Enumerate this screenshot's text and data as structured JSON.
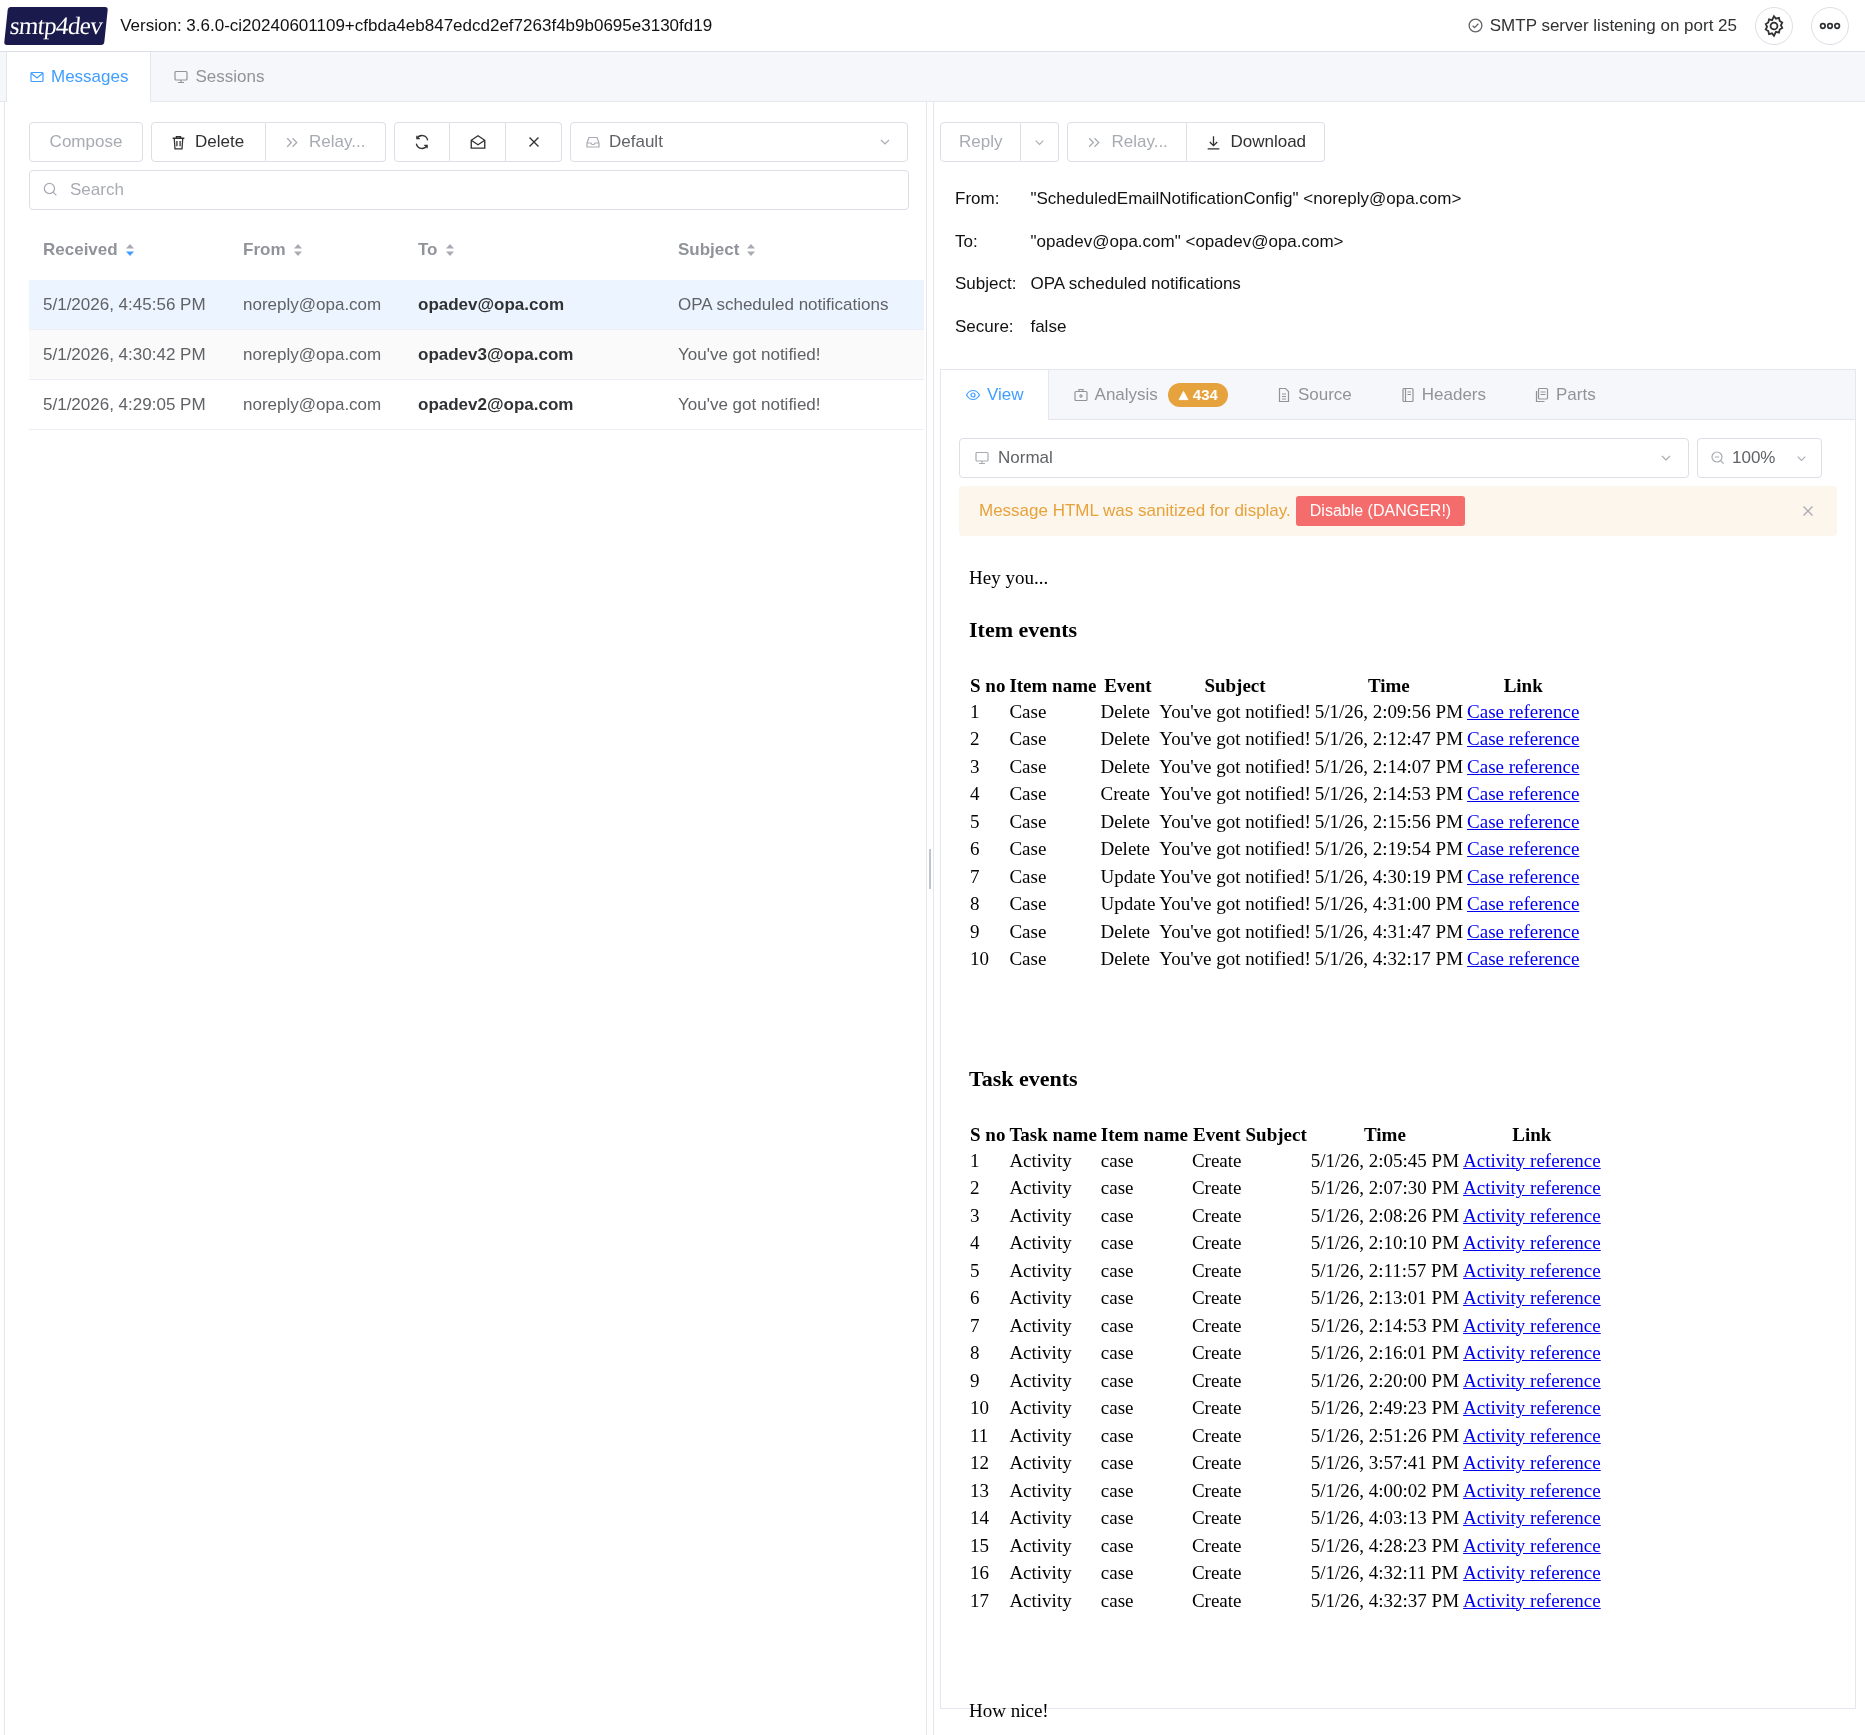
{
  "header": {
    "logo": "smtp4dev",
    "version": "Version: 3.6.0-ci20240601109+cfbda4eb847edcd2ef7263f4b9b0695e3130fd19",
    "status": "SMTP server listening on port 25"
  },
  "tabs": [
    {
      "label": "Messages",
      "selected": true
    },
    {
      "label": "Sessions",
      "selected": false
    }
  ],
  "toolbar": {
    "compose": "Compose",
    "delete": "Delete",
    "relay": "Relay...",
    "mailbox": "Default"
  },
  "search": {
    "placeholder": "Search"
  },
  "messages": {
    "columns": [
      {
        "label": "Received",
        "sorted": true
      },
      {
        "label": "From",
        "sorted": false
      },
      {
        "label": "To",
        "sorted": false
      },
      {
        "label": "Subject",
        "sorted": false
      }
    ],
    "rows": [
      {
        "received": "5/1/2026, 4:45:56 PM",
        "from": "noreply@opa.com",
        "to": "opadev@opa.com",
        "subject": "OPA scheduled notifications",
        "selected": true
      },
      {
        "received": "5/1/2026, 4:30:42 PM",
        "from": "noreply@opa.com",
        "to": "opadev3@opa.com",
        "subject": "You've got notified!",
        "selected": false
      },
      {
        "received": "5/1/2026, 4:29:05 PM",
        "from": "noreply@opa.com",
        "to": "opadev2@opa.com",
        "subject": "You've got notified!",
        "selected": false
      }
    ]
  },
  "detail": {
    "reply": "Reply",
    "relay": "Relay...",
    "download": "Download",
    "fields": [
      {
        "label": "From:",
        "value": "\"ScheduledEmailNotificationConfig\" <noreply@opa.com>"
      },
      {
        "label": "To:",
        "value": "\"opadev@opa.com\" <opadev@opa.com>"
      },
      {
        "label": "Subject:",
        "value": "OPA scheduled notifications"
      },
      {
        "label": "Secure:",
        "value": "false"
      }
    ],
    "tabs": [
      {
        "label": "View",
        "selected": true
      },
      {
        "label": "Analysis",
        "selected": false,
        "badge": "434"
      },
      {
        "label": "Source",
        "selected": false
      },
      {
        "label": "Headers",
        "selected": false
      },
      {
        "label": "Parts",
        "selected": false
      }
    ],
    "view_mode": "Normal",
    "zoom": "100%",
    "warning": {
      "text": "Message HTML was sanitized for display.",
      "button": "Disable (DANGER!)"
    }
  },
  "email": {
    "greeting": "Hey you...",
    "closing": "How nice!",
    "tables": [
      {
        "title": "Item events",
        "columns": [
          "S no",
          "Item name",
          "Event",
          "Subject",
          "Time",
          "Link"
        ],
        "rows": [
          [
            "1",
            "Case",
            "Delete",
            "You've got notified!",
            "5/1/26, 2:09:56 PM",
            "Case reference"
          ],
          [
            "2",
            "Case",
            "Delete",
            "You've got notified!",
            "5/1/26, 2:12:47 PM",
            "Case reference"
          ],
          [
            "3",
            "Case",
            "Delete",
            "You've got notified!",
            "5/1/26, 2:14:07 PM",
            "Case reference"
          ],
          [
            "4",
            "Case",
            "Create",
            "You've got notified!",
            "5/1/26, 2:14:53 PM",
            "Case reference"
          ],
          [
            "5",
            "Case",
            "Delete",
            "You've got notified!",
            "5/1/26, 2:15:56 PM",
            "Case reference"
          ],
          [
            "6",
            "Case",
            "Delete",
            "You've got notified!",
            "5/1/26, 2:19:54 PM",
            "Case reference"
          ],
          [
            "7",
            "Case",
            "Update",
            "You've got notified!",
            "5/1/26, 4:30:19 PM",
            "Case reference"
          ],
          [
            "8",
            "Case",
            "Update",
            "You've got notified!",
            "5/1/26, 4:31:00 PM",
            "Case reference"
          ],
          [
            "9",
            "Case",
            "Delete",
            "You've got notified!",
            "5/1/26, 4:31:47 PM",
            "Case reference"
          ],
          [
            "10",
            "Case",
            "Delete",
            "You've got notified!",
            "5/1/26, 4:32:17 PM",
            "Case reference"
          ]
        ]
      },
      {
        "title": "Task events",
        "columns": [
          "S no",
          "Task name",
          "Item name",
          "Event",
          "Subject",
          "Time",
          "Link"
        ],
        "rows": [
          [
            "1",
            "Activity",
            "case",
            "Create",
            null,
            "5/1/26, 2:05:45 PM",
            "Activity reference"
          ],
          [
            "2",
            "Activity",
            "case",
            "Create",
            null,
            "5/1/26, 2:07:30 PM",
            "Activity reference"
          ],
          [
            "3",
            "Activity",
            "case",
            "Create",
            null,
            "5/1/26, 2:08:26 PM",
            "Activity reference"
          ],
          [
            "4",
            "Activity",
            "case",
            "Create",
            null,
            "5/1/26, 2:10:10 PM",
            "Activity reference"
          ],
          [
            "5",
            "Activity",
            "case",
            "Create",
            null,
            "5/1/26, 2:11:57 PM",
            "Activity reference"
          ],
          [
            "6",
            "Activity",
            "case",
            "Create",
            null,
            "5/1/26, 2:13:01 PM",
            "Activity reference"
          ],
          [
            "7",
            "Activity",
            "case",
            "Create",
            null,
            "5/1/26, 2:14:53 PM",
            "Activity reference"
          ],
          [
            "8",
            "Activity",
            "case",
            "Create",
            null,
            "5/1/26, 2:16:01 PM",
            "Activity reference"
          ],
          [
            "9",
            "Activity",
            "case",
            "Create",
            null,
            "5/1/26, 2:20:00 PM",
            "Activity reference"
          ],
          [
            "10",
            "Activity",
            "case",
            "Create",
            null,
            "5/1/26, 2:49:23 PM",
            "Activity reference"
          ],
          [
            "11",
            "Activity",
            "case",
            "Create",
            null,
            "5/1/26, 2:51:26 PM",
            "Activity reference"
          ],
          [
            "12",
            "Activity",
            "case",
            "Create",
            null,
            "5/1/26, 3:57:41 PM",
            "Activity reference"
          ],
          [
            "13",
            "Activity",
            "case",
            "Create",
            null,
            "5/1/26, 4:00:02 PM",
            "Activity reference"
          ],
          [
            "14",
            "Activity",
            "case",
            "Create",
            null,
            "5/1/26, 4:03:13 PM",
            "Activity reference"
          ],
          [
            "15",
            "Activity",
            "case",
            "Create",
            null,
            "5/1/26, 4:28:23 PM",
            "Activity reference"
          ],
          [
            "16",
            "Activity",
            "case",
            "Create",
            null,
            "5/1/26, 4:32:11 PM",
            "Activity reference"
          ],
          [
            "17",
            "Activity",
            "case",
            "Create",
            null,
            "5/1/26, 4:32:37 PM",
            "Activity reference"
          ]
        ]
      }
    ]
  }
}
